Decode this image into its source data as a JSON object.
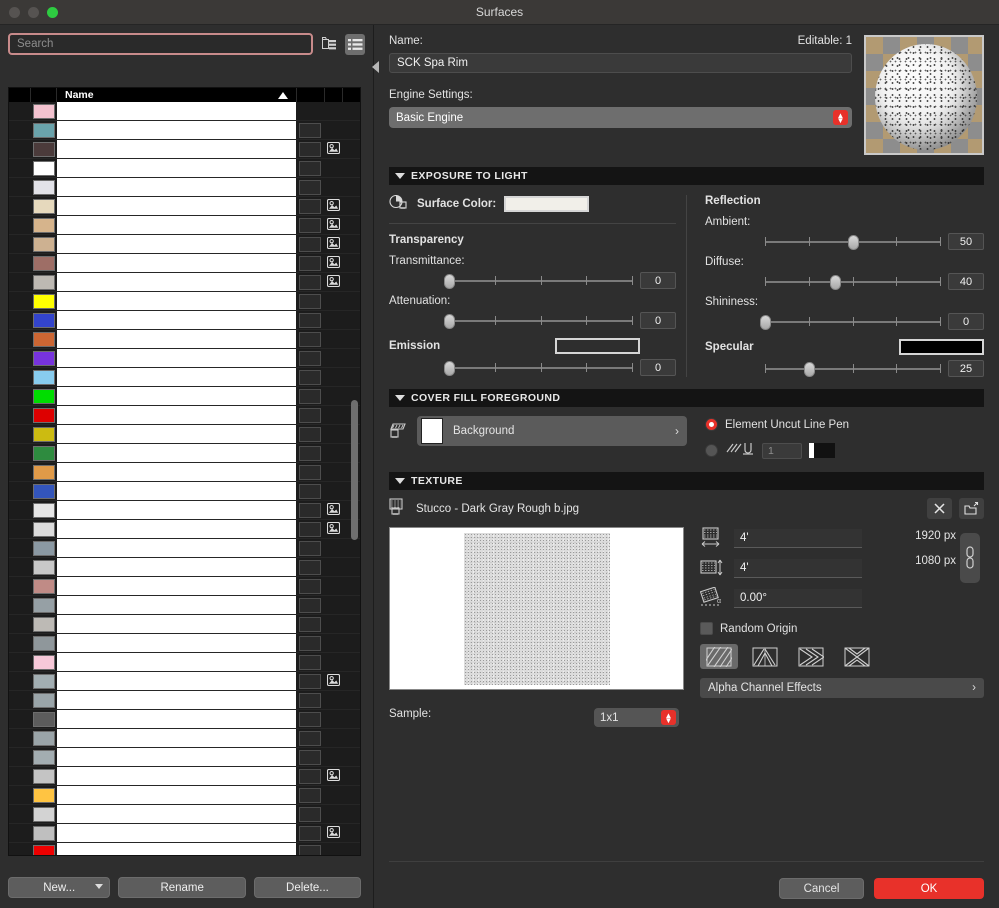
{
  "window": {
    "title": "Surfaces",
    "traffic_lights": [
      "close",
      "minimize",
      "zoom"
    ]
  },
  "left_panel": {
    "search": {
      "placeholder": "Search",
      "value": ""
    },
    "view_buttons": [
      {
        "name": "tree-view-icon",
        "label": "Tree View",
        "active": false
      },
      {
        "name": "list-view-icon",
        "label": "List View",
        "active": true
      }
    ],
    "list_header": {
      "name_column": "Name",
      "sort_direction": "ascending"
    },
    "rows": [
      {
        "swatch": "#f3c2cf",
        "texture": false,
        "preview_icon": false
      },
      {
        "swatch": "#6aa3ab",
        "texture": true,
        "preview_icon": false
      },
      {
        "swatch": "#4b3b3b",
        "texture": true,
        "preview_icon": true
      },
      {
        "swatch": "#ffffff",
        "texture": true,
        "preview_icon": false
      },
      {
        "swatch": "#e2e2e8",
        "texture": true,
        "preview_icon": false
      },
      {
        "swatch": "#e6d9bd",
        "texture": true,
        "preview_icon": true
      },
      {
        "swatch": "#d6b48c",
        "texture": true,
        "preview_icon": true
      },
      {
        "swatch": "#cdb191",
        "texture": true,
        "preview_icon": true
      },
      {
        "swatch": "#9e6e66",
        "texture": true,
        "preview_icon": true
      },
      {
        "swatch": "#bdb9b3",
        "texture": true,
        "preview_icon": true
      },
      {
        "swatch": "#ffff00",
        "texture": true,
        "preview_icon": false
      },
      {
        "swatch": "#3344cc",
        "texture": true,
        "preview_icon": false
      },
      {
        "swatch": "#cc6633",
        "texture": true,
        "preview_icon": false
      },
      {
        "swatch": "#7733dd",
        "texture": true,
        "preview_icon": false
      },
      {
        "swatch": "#88ccee",
        "texture": true,
        "preview_icon": false
      },
      {
        "swatch": "#00dd00",
        "texture": true,
        "preview_icon": false
      },
      {
        "swatch": "#dd0000",
        "texture": true,
        "preview_icon": false
      },
      {
        "swatch": "#ccbb11",
        "texture": true,
        "preview_icon": false
      },
      {
        "swatch": "#2e8b3f",
        "texture": true,
        "preview_icon": false
      },
      {
        "swatch": "#e09a48",
        "texture": true,
        "preview_icon": false
      },
      {
        "swatch": "#3355bb",
        "texture": true,
        "preview_icon": false
      },
      {
        "swatch": "#e6e6e6",
        "texture": true,
        "preview_icon": true
      },
      {
        "swatch": "#dcdcdc",
        "texture": true,
        "preview_icon": true
      },
      {
        "swatch": "#8b99a3",
        "texture": true,
        "preview_icon": false
      },
      {
        "swatch": "#c8c8c8",
        "texture": true,
        "preview_icon": false
      },
      {
        "swatch": "#c08b86",
        "texture": true,
        "preview_icon": false
      },
      {
        "swatch": "#96a0a5",
        "texture": true,
        "preview_icon": false
      },
      {
        "swatch": "#bdbab5",
        "texture": true,
        "preview_icon": false
      },
      {
        "swatch": "#8f979b",
        "texture": true,
        "preview_icon": false
      },
      {
        "swatch": "#f7c8d8",
        "texture": true,
        "preview_icon": false
      },
      {
        "swatch": "#a2aeb2",
        "texture": true,
        "preview_icon": true
      },
      {
        "swatch": "#9aa5a9",
        "texture": true,
        "preview_icon": false
      },
      {
        "swatch": "#5c5c5c",
        "texture": true,
        "preview_icon": false
      },
      {
        "swatch": "#9aa4a8",
        "texture": true,
        "preview_icon": false
      },
      {
        "swatch": "#a3adb1",
        "texture": true,
        "preview_icon": false
      },
      {
        "swatch": "#c4c4c4",
        "texture": true,
        "preview_icon": true
      },
      {
        "swatch": "#ffc442",
        "texture": true,
        "preview_icon": false
      },
      {
        "swatch": "#d3d3d3",
        "texture": true,
        "preview_icon": false
      },
      {
        "swatch": "#bfbfbf",
        "texture": true,
        "preview_icon": true
      },
      {
        "swatch": "#ee0000",
        "texture": true,
        "preview_icon": false
      },
      {
        "swatch": "#b3b3b3",
        "texture": true,
        "preview_icon": false
      },
      {
        "swatch": "#0f8a17",
        "texture": true,
        "preview_icon": false
      }
    ],
    "footer_buttons": {
      "new": "New...",
      "rename": "Rename",
      "delete": "Delete..."
    }
  },
  "right_panel": {
    "name_label": "Name:",
    "name_value": "SCK Spa Rim",
    "editable_label": "Editable: 1",
    "engine_label": "Engine Settings:",
    "engine_value": "Basic Engine",
    "preview_name": "surface-preview-sphere",
    "exposure": {
      "header": "EXPOSURE TO LIGHT",
      "surface_color_label": "Surface Color:",
      "surface_color_value": "#f1efe9",
      "transparency_label": "Transparency",
      "reflection_label": "Reflection",
      "sliders": [
        {
          "label": "Transmittance:",
          "value": 0,
          "percent": 0,
          "column": "left"
        },
        {
          "label": "Attenuation:",
          "value": 0,
          "percent": 0,
          "column": "left"
        },
        {
          "label": "Ambient:",
          "value": 50,
          "percent": 50,
          "column": "right"
        },
        {
          "label": "Diffuse:",
          "value": 40,
          "percent": 40,
          "column": "right"
        },
        {
          "label": "Shininess:",
          "value": 0,
          "percent": 0,
          "column": "right"
        }
      ],
      "emission_label": "Emission",
      "emission_color_value": "#2e2e2e",
      "emission_value": 0,
      "emission_percent": 0,
      "specular_label": "Specular",
      "specular_color_value": "#000000",
      "specular_value": 25,
      "specular_percent": 25
    },
    "cover_fill": {
      "header": "COVER FILL FOREGROUND",
      "fill_name": "Background",
      "fill_swatch": "#ffffff",
      "pen_radio_label": "Element Uncut Line Pen",
      "pen_radio_selected": true,
      "custom_pen_value": "1",
      "custom_pen_color": "#111111"
    },
    "texture": {
      "header": "TEXTURE",
      "file_name": "Stucco - Dark Gray Rough b.jpg",
      "remove_button": "remove-texture",
      "browse_button": "browse-texture",
      "width_value": "4'",
      "height_value": "4'",
      "angle_value": "0.00°",
      "width_px": "1920 px",
      "height_px": "1080 px",
      "link_name": "link-proportions",
      "random_origin_label": "Random Origin",
      "random_origin_checked": false,
      "orientations": [
        "mirror-none",
        "mirror-horizontal",
        "mirror-vertical",
        "mirror-both"
      ],
      "orientation_selected": 0,
      "alpha_label": "Alpha Channel Effects",
      "sample_label": "Sample:",
      "sample_value": "1x1"
    },
    "footer_buttons": {
      "cancel": "Cancel",
      "ok": "OK"
    }
  }
}
